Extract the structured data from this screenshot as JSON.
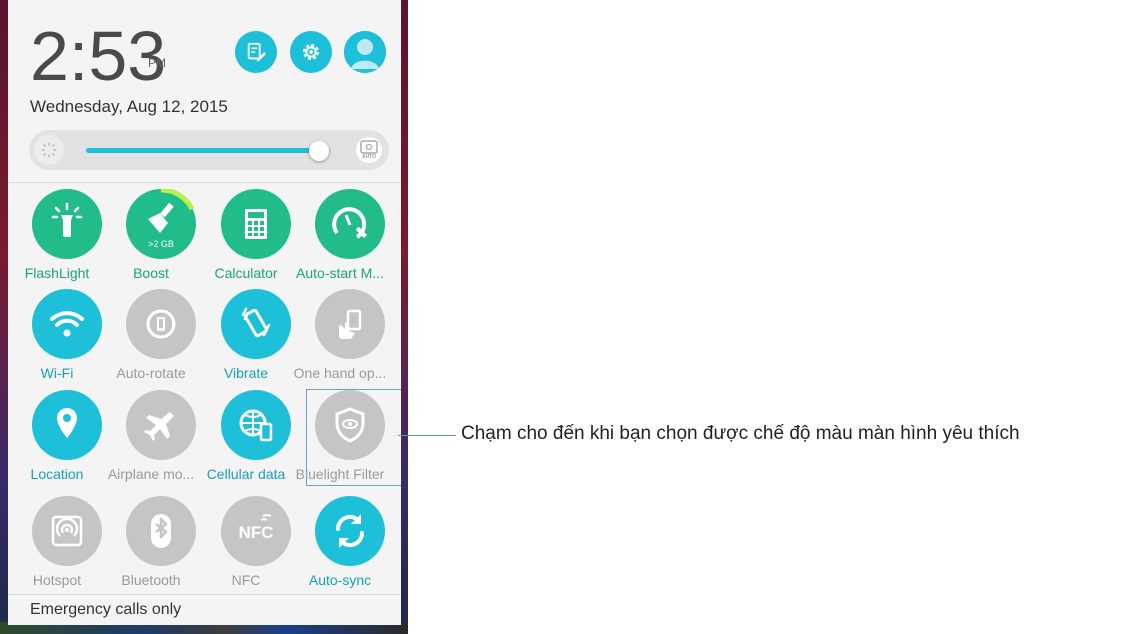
{
  "status": {
    "time": "2:53",
    "ampm": "PM",
    "date": "Wednesday, Aug 12, 2015"
  },
  "top_icons": [
    "edit-icon",
    "settings-gear-icon",
    "user-avatar-icon"
  ],
  "brightness": {
    "level": 0.95,
    "auto_label": "AUTO"
  },
  "tiles": [
    {
      "label": "FlashLight",
      "icon": "flashlight-icon",
      "state": "green"
    },
    {
      "label": "Boost",
      "icon": "boost-broom-icon",
      "state": "green",
      "badge": ">2 GB"
    },
    {
      "label": "Calculator",
      "icon": "calculator-icon",
      "state": "green"
    },
    {
      "label": "Auto-start M...",
      "icon": "gauge-wrench-icon",
      "state": "green"
    },
    {
      "label": "Wi-Fi",
      "icon": "wifi-icon",
      "state": "on"
    },
    {
      "label": "Auto-rotate",
      "icon": "auto-rotate-icon",
      "state": "off"
    },
    {
      "label": "Vibrate",
      "icon": "vibrate-icon",
      "state": "on"
    },
    {
      "label": "One hand op...",
      "icon": "one-hand-icon",
      "state": "off"
    },
    {
      "label": "Location",
      "icon": "location-pin-icon",
      "state": "on"
    },
    {
      "label": "Airplane mo...",
      "icon": "airplane-icon",
      "state": "off"
    },
    {
      "label": "Cellular data",
      "icon": "cellular-data-icon",
      "state": "on"
    },
    {
      "label": "Bluelight Filter",
      "icon": "bluelight-shield-icon",
      "state": "off"
    },
    {
      "label": "Hotspot",
      "icon": "hotspot-icon",
      "state": "off"
    },
    {
      "label": "Bluetooth",
      "icon": "bluetooth-icon",
      "state": "off"
    },
    {
      "label": "NFC",
      "icon": "nfc-icon",
      "state": "off"
    },
    {
      "label": "Auto-sync",
      "icon": "sync-icon",
      "state": "on"
    }
  ],
  "footer": {
    "emergency": "Emergency calls only"
  },
  "callout": {
    "text": "Chạm cho đến khi bạn chọn được chế độ màu màn hình yêu thích"
  },
  "colors": {
    "accent": "#1ec0d9",
    "green": "#21bc8a",
    "inactive": "#c5c5c5"
  }
}
